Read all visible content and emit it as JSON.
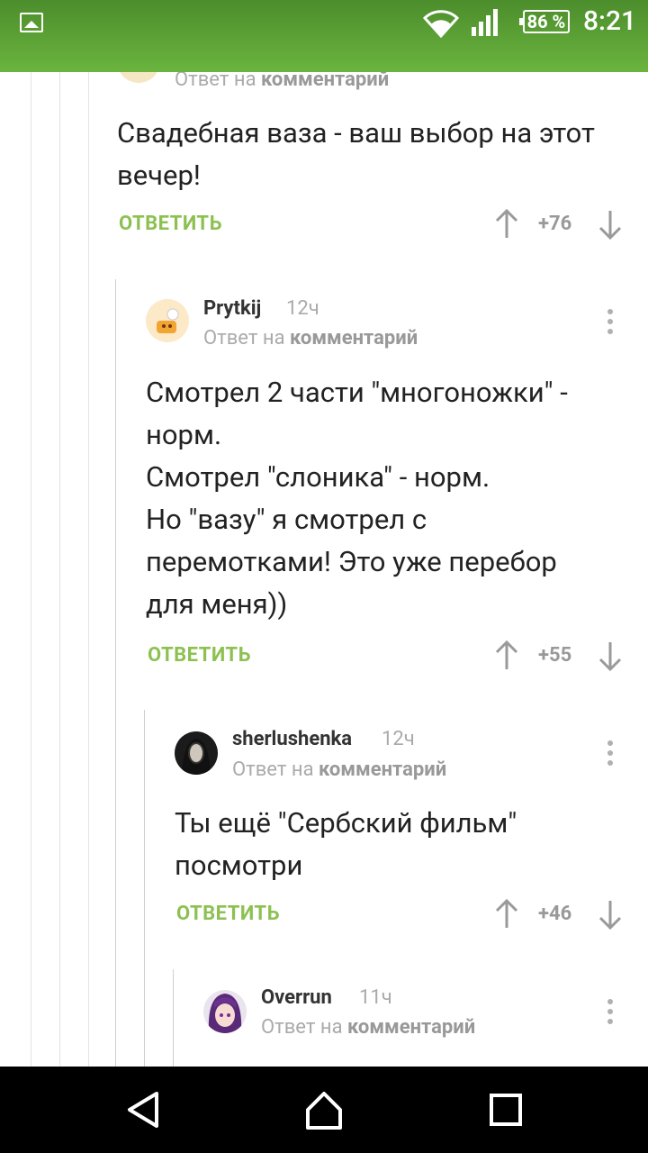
{
  "status_bar": {
    "battery": "86 %",
    "time": "8:21"
  },
  "reply_to_prefix": "Ответ на",
  "reply_to_link": "комментарий",
  "reply_label": "ОТВЕТИТЬ",
  "comments": [
    {
      "text": "Свадебная ваза - ваш выбор на этот вечер!",
      "score": "+76"
    },
    {
      "user": "Prytkij",
      "time": "12ч",
      "text_lines": [
        "Смотрел 2 части \"многоножки\" -",
        "норм.",
        "Смотрел \"слоника\" - норм.",
        "Но \"вазу\" я смотрел с",
        "перемотками! Это уже перебор",
        "для меня))"
      ],
      "score": "+55"
    },
    {
      "user": "sherlushenka",
      "time": "12ч",
      "text_lines": [
        "Ты ещё \"Сербский фильм\"",
        "посмотри"
      ],
      "score": "+46"
    },
    {
      "user": "Overrun",
      "time": "11ч"
    }
  ],
  "icons": {
    "status_image": "image-icon",
    "wifi": "wifi-icon",
    "signal": "cell-signal-icon",
    "more": "more-vertical-icon",
    "up": "arrow-up-icon",
    "down": "arrow-down-icon",
    "back": "nav-back-icon",
    "home": "nav-home-icon",
    "recent": "nav-recent-icon"
  },
  "colors": {
    "accent": "#8cc152",
    "status_bar": "#5ca335"
  }
}
